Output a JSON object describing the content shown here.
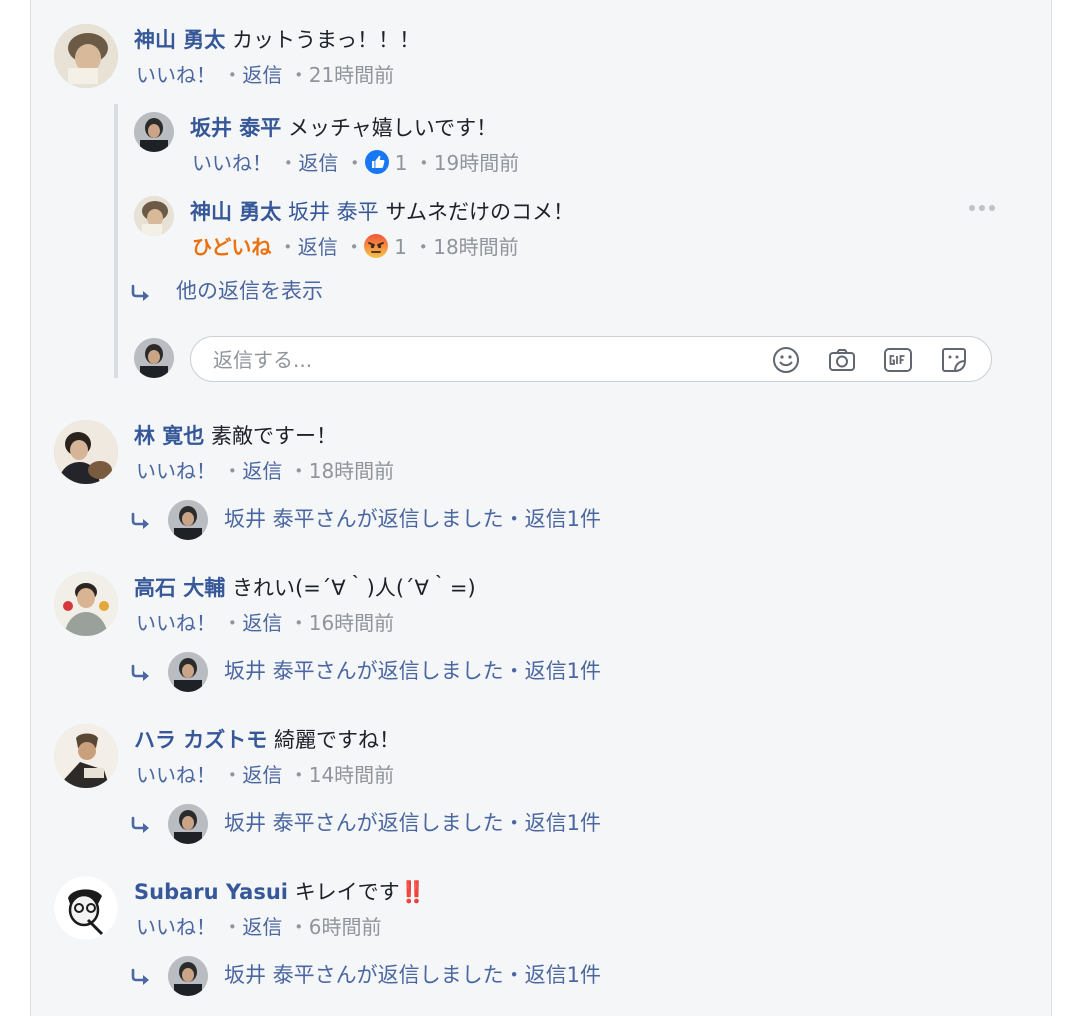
{
  "comments": {
    "c1": {
      "author": "神山 勇太",
      "text": "カットうまっ！！！",
      "like": "いいね！",
      "reply": "返信",
      "time": "21時間前"
    },
    "c1r1": {
      "author": "坂井 泰平",
      "text": "メッチャ嬉しいです！",
      "like": "いいね！",
      "reply": "返信",
      "reaction_count": "1",
      "time": "19時間前",
      "reaction": "like-icon",
      "reaction_color": "#1877f2"
    },
    "c1r2": {
      "author": "神山 勇太",
      "mention": "坂井 泰平",
      "text": "サムネだけのコメ！",
      "like": "ひどいね",
      "reply": "返信",
      "reaction_count": "1",
      "time": "18時間前",
      "reaction": "angry-icon",
      "reaction_color": "#e9710f"
    },
    "c1_more_replies": "他の返信を表示",
    "reply_input": {
      "placeholder": "返信する..."
    },
    "c2": {
      "author": "林 寛也",
      "text": "素敵ですー！",
      "like": "いいね！",
      "reply": "返信",
      "time": "18時間前",
      "reply_summary": "坂井 泰平さんが返信しました・返信1件"
    },
    "c3": {
      "author": "高石 大輔",
      "text": "きれい(=´∀｀)人(´∀｀=)",
      "like": "いいね！",
      "reply": "返信",
      "time": "16時間前",
      "reply_summary": "坂井 泰平さんが返信しました・返信1件"
    },
    "c4": {
      "author": "ハラ カズトモ",
      "text": "綺麗ですね！",
      "like": "いいね！",
      "reply": "返信",
      "time": "14時間前",
      "reply_summary": "坂井 泰平さんが返信しました・返信1件"
    },
    "c5": {
      "author": "Subaru Yasui",
      "text": "キレイです",
      "emoji": "‼️",
      "like": "いいね！",
      "reply": "返信",
      "time": "6時間前",
      "reply_summary": "坂井 泰平さんが返信しました・返信1件"
    }
  },
  "colors": {
    "link": "#365899",
    "meta": "#90949c",
    "background": "#f5f6f7"
  },
  "separator": "・"
}
